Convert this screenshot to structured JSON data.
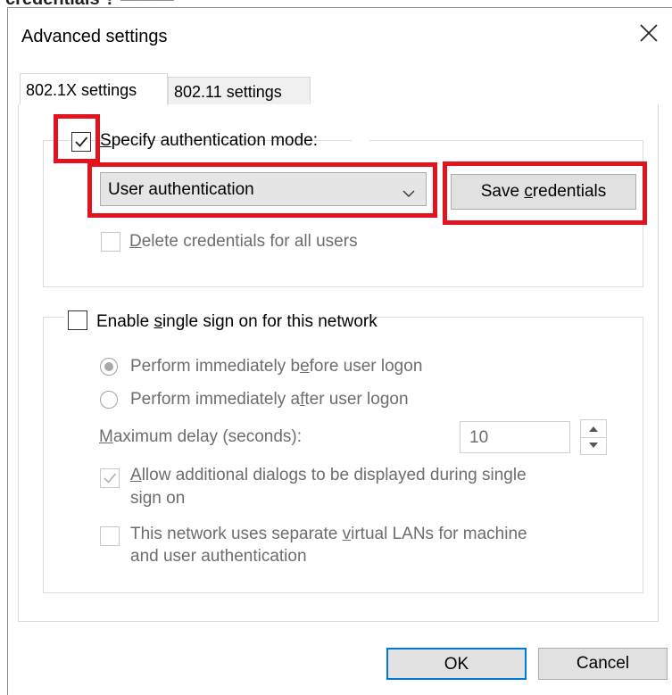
{
  "overlay_cut_text": "credentials  ?  ———",
  "dialog": {
    "title": "Advanced settings",
    "close_icon": "close-icon"
  },
  "tabs": [
    {
      "label": "802.1X settings",
      "active": true
    },
    {
      "label": "802.11 settings",
      "active": false
    }
  ],
  "auth_group": {
    "checkbox_checked": true,
    "label_prefix": "",
    "label_underline": "S",
    "label_rest": "pecify authentication mode:",
    "mode_value": "User authentication",
    "save_credentials_pre": "Save ",
    "save_credentials_u": "c",
    "save_credentials_post": "redentials",
    "delete_u": "D",
    "delete_rest": "elete credentials for all users"
  },
  "sso_group": {
    "checkbox_checked": false,
    "label_pre": "Enable ",
    "label_u": "s",
    "label_post": "ingle sign on for this network",
    "radio_before_pre": "Perform immediately b",
    "radio_before_u": "e",
    "radio_before_post": "fore user logon",
    "radio_after_pre": "Perform immediately a",
    "radio_after_u": "f",
    "radio_after_post": "ter user logon",
    "max_delay_u": "M",
    "max_delay_rest": "aximum delay (seconds):",
    "max_delay_value": "10",
    "allow_u": "A",
    "allow_rest_line1": "llow additional dialogs to be displayed during single",
    "allow_line2": "sign on",
    "vlan_line1_pre": "This network uses separate ",
    "vlan_line1_u": "v",
    "vlan_line1_post": "irtual LANs for machine",
    "vlan_line2": "and user authentication"
  },
  "footer": {
    "ok_label": "OK",
    "cancel_label": "Cancel"
  },
  "colors": {
    "highlight_red": "#e0131e",
    "default_button_border": "#0078d7"
  }
}
